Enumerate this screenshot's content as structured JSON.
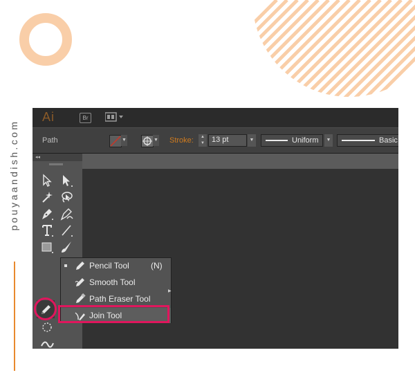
{
  "watermark": {
    "site": "pouyaandish.com"
  },
  "app": {
    "logo": "Ai",
    "bridge_label": "Br"
  },
  "control_bar": {
    "selection_label": "Path",
    "stroke_label": "Stroke:",
    "stroke_weight": "13 pt",
    "variable_width_profile": "Uniform",
    "brush_definition": "Basic"
  },
  "flyout": {
    "items": [
      {
        "label": "Pencil Tool",
        "shortcut": "(N)",
        "selected": true
      },
      {
        "label": "Smooth Tool",
        "shortcut": ""
      },
      {
        "label": "Path Eraser Tool",
        "shortcut": ""
      },
      {
        "label": "Join Tool",
        "shortcut": "",
        "highlighted": true
      }
    ]
  },
  "colors": {
    "highlight": "#e0165d",
    "stroke_label": "#d07b1e",
    "accent_orange": "#e8892e",
    "decor_peach": "#f9cea8"
  },
  "icons": {
    "toolbox": [
      "selection-icon",
      "direct-selection-icon",
      "magic-wand-icon",
      "lasso-icon",
      "pen-icon",
      "curvature-icon",
      "type-icon",
      "line-icon",
      "rectangle-icon",
      "paintbrush-icon",
      "pencil-icon",
      "blob-brush-icon",
      "eraser-icon",
      "rotate-icon",
      "width-icon",
      "warp-icon",
      "free-transform-icon",
      "shape-builder-icon",
      "mesh-icon",
      "gradient-icon",
      "eyedropper-icon",
      "blend-icon"
    ]
  }
}
